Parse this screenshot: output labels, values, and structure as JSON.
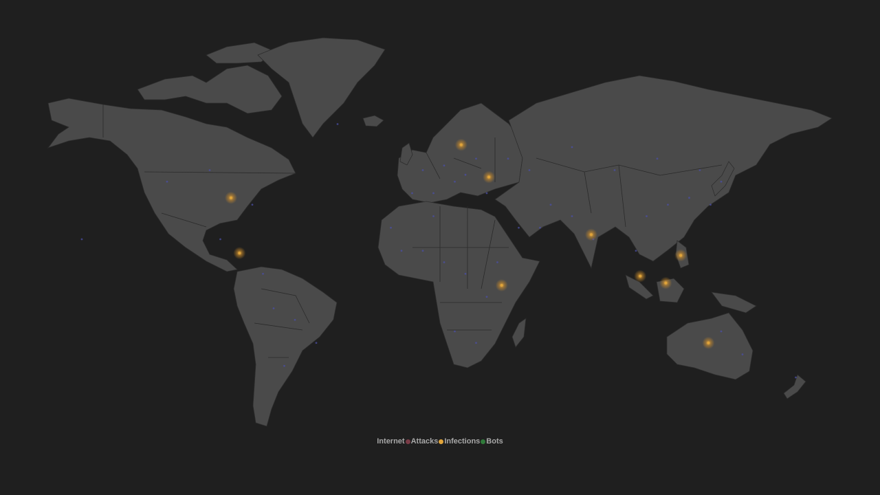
{
  "legend": {
    "items": [
      {
        "label": "Internet",
        "color": ""
      },
      {
        "label": "Attacks",
        "color": "#7a3b46"
      },
      {
        "label": "Infections",
        "color": "#e0a43a"
      },
      {
        "label": "Bots",
        "color": "#2f7a3a"
      }
    ]
  },
  "colors": {
    "background": "#1f1f1f",
    "land": "#4a4a4a",
    "internet_node": "#4b4fa6",
    "infection": "#e0a43a"
  },
  "infections": [
    {
      "region": "Scandinavia",
      "lon": 18,
      "lat": 61
    },
    {
      "region": "Ukraine",
      "lon": 31,
      "lat": 47
    },
    {
      "region": "Central America",
      "lon": -86,
      "lat": 14
    },
    {
      "region": "Kenya",
      "lon": 37,
      "lat": 0
    },
    {
      "region": "Malaysia",
      "lon": 102,
      "lat": 4
    },
    {
      "region": "Borneo",
      "lon": 114,
      "lat": 1
    },
    {
      "region": "Philippines",
      "lon": 121,
      "lat": 13
    },
    {
      "region": "USA",
      "lon": -90,
      "lat": 38
    },
    {
      "region": "India",
      "lon": 79,
      "lat": 22
    },
    {
      "region": "Australia",
      "lon": 134,
      "lat": -25
    }
  ]
}
